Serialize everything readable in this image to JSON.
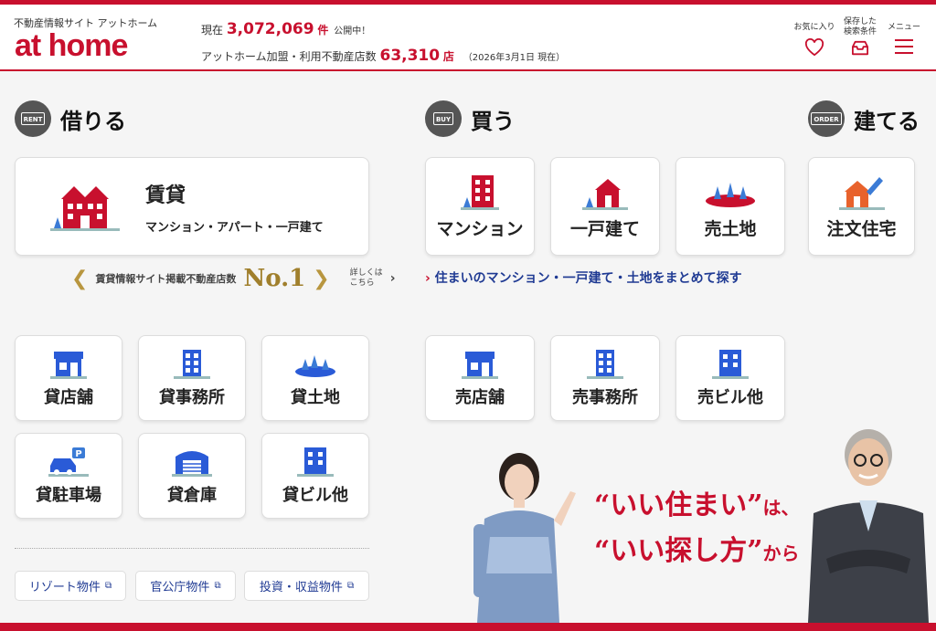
{
  "header": {
    "tagline": "不動産情報サイト アットホーム",
    "logo": "at home",
    "stat1_prefix": "現在",
    "stat1_num": "3,072,069",
    "stat1_unit": "件",
    "stat1_suffix": "公開中！",
    "stat2_prefix": "アットホーム加盟・利用不動産店数",
    "stat2_num": "63,310",
    "stat2_unit": "店",
    "stat2_date": "（2026年3月1日 現在）",
    "favorites_label": "お気に入り",
    "saved_search_label_1": "保存した",
    "saved_search_label_2": "検索条件",
    "menu_label": "メニュー"
  },
  "rent": {
    "badge": "RENT",
    "title": "借りる",
    "main_title": "賃貸",
    "main_sub": "マンション・アパート・一戸建て",
    "award_text": "賃貸情報サイト掲載不動産店数",
    "award_rank": "No.1",
    "award_more_1": "詳しくは",
    "award_more_2": "こちら",
    "items": [
      "貸店舗",
      "貸事務所",
      "貸土地",
      "貸駐車場",
      "貸倉庫",
      "貸ビル他"
    ]
  },
  "buy": {
    "badge": "BUY",
    "title": "買う",
    "items": [
      "マンション",
      "一戸建て",
      "売土地"
    ],
    "bulk_link": "住まいのマンション・一戸建て・土地をまとめて探す",
    "items2": [
      "売店舗",
      "売事務所",
      "売ビル他"
    ]
  },
  "build": {
    "badge": "ORDER",
    "title": "建てる",
    "item": "注文住宅"
  },
  "links": [
    "リゾート物件",
    "官公庁物件",
    "投資・収益物件"
  ],
  "slogan": {
    "line1": "“いい住まい”",
    "line1_small": "は、",
    "line2": "“いい探し方”",
    "line2_small": "から"
  },
  "colors": {
    "brand": "#c8102e",
    "icon_blue": "#2a5bd7",
    "link": "#1f3a93"
  }
}
